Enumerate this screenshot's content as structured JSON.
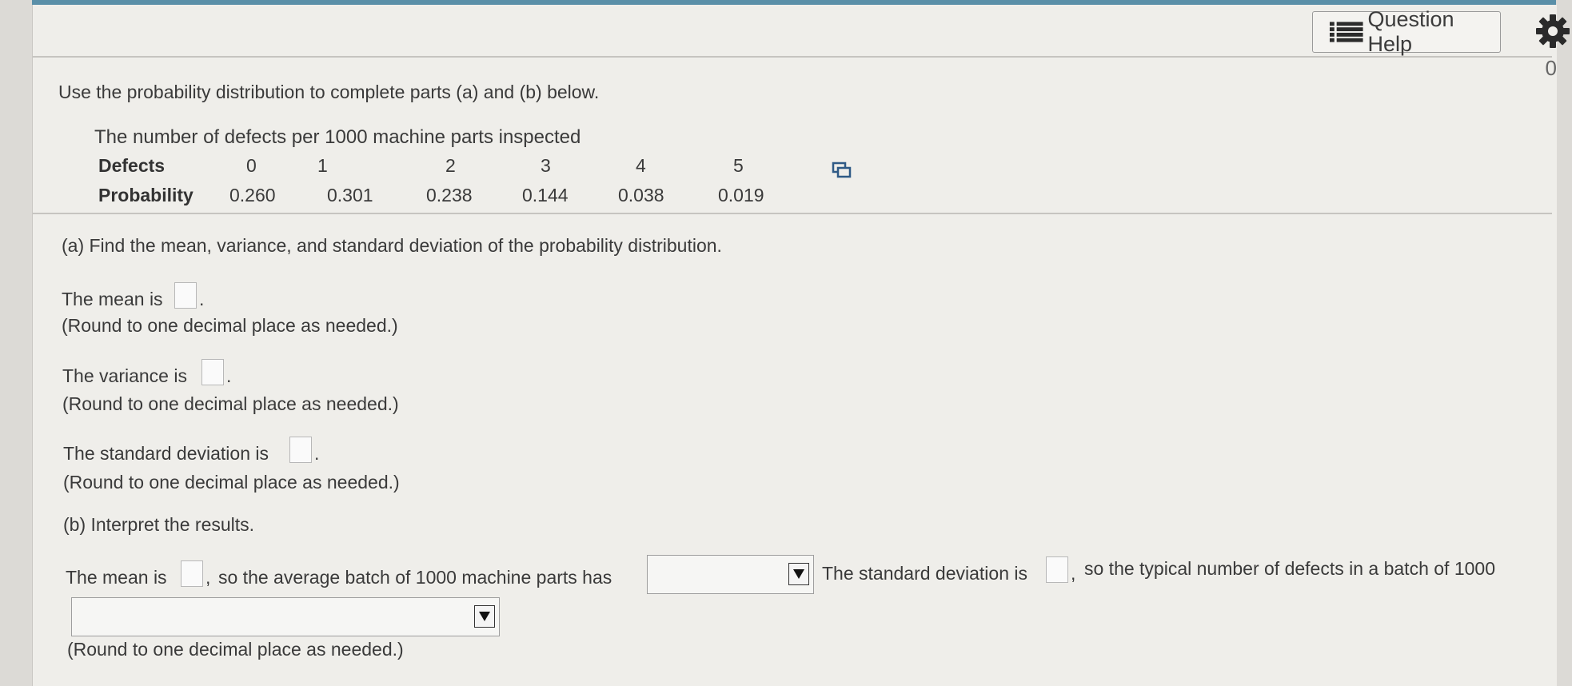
{
  "header": {
    "help_label": "Question Help",
    "edge_digit": "0",
    "icons": [
      "list-icon",
      "gear-icon"
    ]
  },
  "intro": "Use the probability distribution to complete parts (a) and (b) below.",
  "table": {
    "caption": "The number of defects per 1000 machine parts inspected",
    "row_header_defects": "Defects",
    "row_header_probability": "Probability",
    "defects": [
      "0",
      "1",
      "2",
      "3",
      "4",
      "5"
    ],
    "probabilities": [
      "0.260",
      "0.301",
      "0.238",
      "0.144",
      "0.038",
      "0.019"
    ]
  },
  "part_a": {
    "prompt": "(a) Find the mean, variance, and standard deviation of the probability distribution.",
    "mean_label": "The mean is",
    "variance_label": "The variance is",
    "sd_label": "The standard deviation is",
    "round_note": "(Round to one decimal place as needed.)",
    "period": "."
  },
  "part_b": {
    "prompt": "(b) Interpret the results.",
    "mean_label": "The mean is",
    "comma": ",",
    "mean_text": "so the average batch of 1000 machine parts has",
    "sd_label": "The standard deviation is",
    "sd_text": "so the typical number of defects in a batch of 1000",
    "dropdown1_value": "",
    "dropdown2_value": "",
    "round_note": "(Round to one decimal place as needed.)"
  }
}
